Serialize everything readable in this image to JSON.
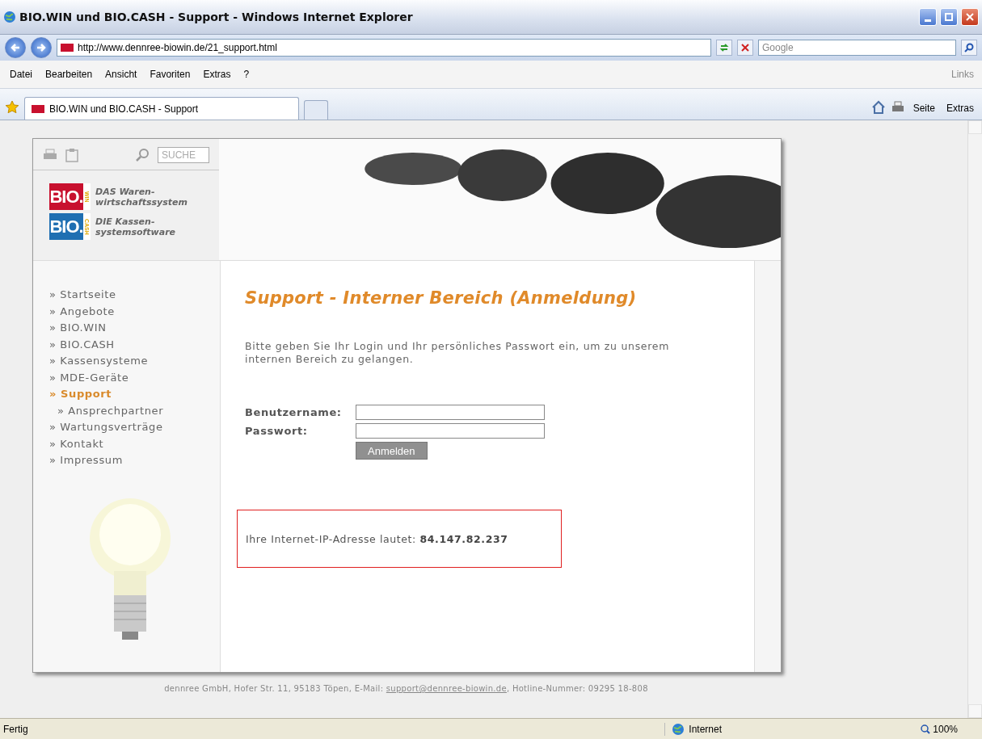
{
  "window": {
    "title": "BIO.WIN und BIO.CASH - Support - Windows Internet Explorer"
  },
  "address_bar": {
    "url": "http://www.dennree-biowin.de/21_support.html",
    "search_placeholder": "Google"
  },
  "menu": [
    "Datei",
    "Bearbeiten",
    "Ansicht",
    "Favoriten",
    "Extras",
    "?"
  ],
  "links_label": "Links",
  "tabs": [
    {
      "label": "BIO.WIN und BIO.CASH - Support",
      "selected": true
    }
  ],
  "command_bar": [
    "Seite",
    "Extras"
  ],
  "page": {
    "search": {
      "placeholder": "SUCHE"
    },
    "logos": [
      {
        "brand": "BIO.",
        "suffix": "WIN",
        "line1": "DAS Waren-",
        "line2": "wirtschaftssystem",
        "color": "#c8102e"
      },
      {
        "brand": "BIO.",
        "suffix": "CASH",
        "line1": "DIE Kassen-",
        "line2": "systemsoftware",
        "color": "#1f6fb2"
      }
    ],
    "nav": [
      {
        "label": "Startseite",
        "selected": false
      },
      {
        "label": "Angebote",
        "selected": false
      },
      {
        "label": "BIO.WIN",
        "selected": false
      },
      {
        "label": "BIO.CASH",
        "selected": false
      },
      {
        "label": "Kassensysteme",
        "selected": false
      },
      {
        "label": "MDE-Geräte",
        "selected": false
      },
      {
        "label": "Support",
        "selected": true,
        "children": [
          {
            "label": "Ansprechpartner",
            "selected": false
          }
        ]
      },
      {
        "label": "Wartungsverträge",
        "selected": false
      },
      {
        "label": "Kontakt",
        "selected": false
      },
      {
        "label": "Impressum",
        "selected": false
      }
    ],
    "nav_marker": "»",
    "heading": "Support - Interner Bereich (Anmeldung)",
    "intro": "Bitte geben Sie Ihr Login und Ihr persönliches Passwort ein, um zu unserem internen Bereich zu gelangen.",
    "form": {
      "fields": [
        {
          "label": "Benutzername:"
        },
        {
          "label": "Passwort:"
        }
      ],
      "button": "Anmelden"
    },
    "ip_notice": "Ihre Internet-IP-Adresse lautet: **84.147.82.237**",
    "footer": {
      "before": "dennree GmbH, Hofer Str. 11, 95183 Töpen, E-Mail: ",
      "email": "support@dennree-biowin.de",
      "after": ", Hotline-Nummer: 09295 18-808"
    }
  },
  "status_bar": {
    "text": "Fertig",
    "zone": "Internet",
    "zoom": "100%"
  }
}
